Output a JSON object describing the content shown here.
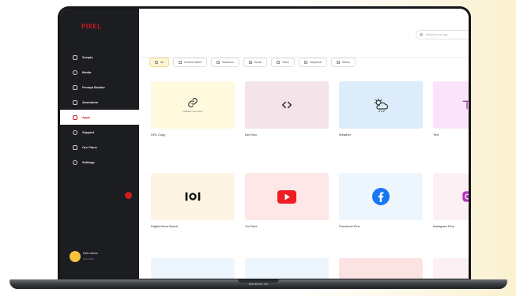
{
  "sidebar": {
    "logo": "PIXEL",
    "items": [
      {
        "label": "Scripts"
      },
      {
        "label": "Media"
      },
      {
        "label": "Prompt Builder"
      },
      {
        "label": "Assistants"
      },
      {
        "label": "Apps"
      },
      {
        "label": "Support"
      },
      {
        "label": "Our Plans"
      },
      {
        "label": "Settings"
      }
    ],
    "active_index": 4,
    "user": {
      "name": "Hello Adrian",
      "role": "Subscriber"
    }
  },
  "search": {
    "placeholder": "Search for an app"
  },
  "filters": [
    {
      "label": "All",
      "active": true
    },
    {
      "label": "Content Writer",
      "active": false
    },
    {
      "label": "Business",
      "active": false
    },
    {
      "label": "Social",
      "active": false
    },
    {
      "label": "Video",
      "active": false
    },
    {
      "label": "Helpdesk",
      "active": false
    },
    {
      "label": "Others",
      "active": false
    }
  ],
  "apps": [
    {
      "title": "URL Copy",
      "thumb_sub": "Fallback Generator",
      "icon": "link-icon"
    },
    {
      "title": "Dev Box",
      "icon": "code-icon"
    },
    {
      "title": "Weather",
      "icon": "weather-icon"
    },
    {
      "title": "Text",
      "icon": "text-icon"
    },
    {
      "title": "Digital Menu Board",
      "icon": "menu-board-icon"
    },
    {
      "title": "YouTube",
      "icon": "youtube-icon"
    },
    {
      "title": "Facebook Plus",
      "icon": "facebook-icon"
    },
    {
      "title": "Instagram Plus",
      "icon": "instagram-icon"
    }
  ],
  "laptop_label": "MacBook Air",
  "colors": {
    "brand": "#d11b22",
    "sidebar": "#1c1d20",
    "active_filter": "#fff6d6"
  }
}
